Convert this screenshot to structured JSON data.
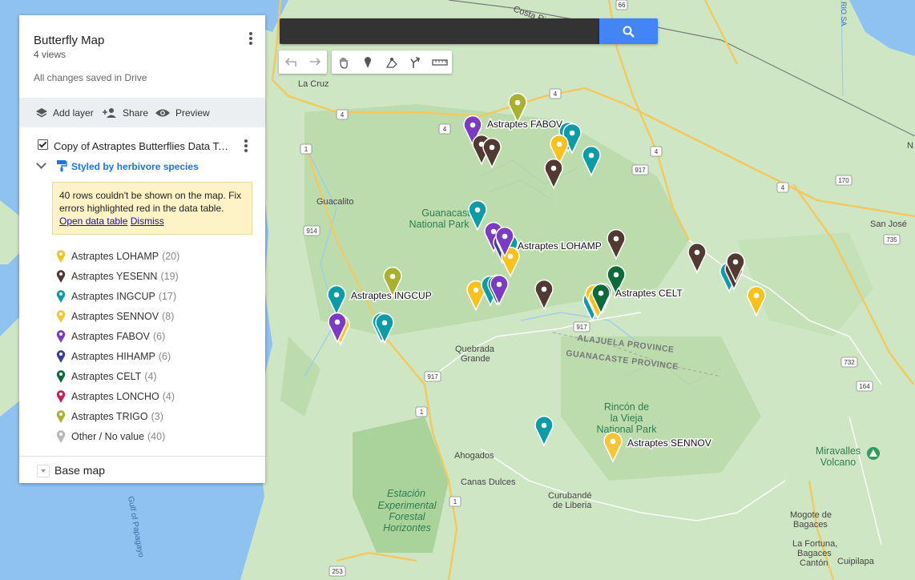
{
  "panel": {
    "title": "Butterfly Map",
    "views": "4 views",
    "saved_status": "All changes saved in Drive",
    "actions": {
      "add_layer": "Add layer",
      "share": "Share",
      "preview": "Preview"
    },
    "layer": {
      "name": "Copy of Astraptes Butterflies Data Table",
      "checked": true,
      "style_label": "Styled by herbivore species"
    },
    "warning": {
      "text": "40 rows couldn't be shown on the map. Fix errors highlighted red in the data table.",
      "open_link": "Open data table",
      "dismiss_link": "Dismiss"
    },
    "legend": [
      {
        "name": "Astraptes LOHAMP",
        "count": "(20)",
        "color": "#f9c11c"
      },
      {
        "name": "Astraptes YESENN",
        "count": "(19)",
        "color": "#523a33"
      },
      {
        "name": "Astraptes INGCUP",
        "count": "(17)",
        "color": "#0d9ba8"
      },
      {
        "name": "Astraptes SENNOV",
        "count": "(8)",
        "color": "#f7c535"
      },
      {
        "name": "Astraptes FABOV",
        "count": "(6)",
        "color": "#7b3bc2"
      },
      {
        "name": "Astraptes HIHAMP",
        "count": "(6)",
        "color": "#3c3f9e"
      },
      {
        "name": "Astraptes CELT",
        "count": "(4)",
        "color": "#0b6b3a"
      },
      {
        "name": "Astraptes LONCHO",
        "count": "(4)",
        "color": "#c9205c"
      },
      {
        "name": "Astraptes TRIGO",
        "count": "(3)",
        "color": "#a8b22f"
      },
      {
        "name": "Other / No value",
        "count": "(40)",
        "color": "#b8b8b8"
      }
    ],
    "base_map": "Base map"
  },
  "search": {
    "value": "",
    "placeholder": ""
  },
  "toolbar": [
    "undo-icon",
    "redo-icon",
    "hand-icon",
    "marker-icon",
    "draw-line-icon",
    "directions-icon",
    "ruler-icon"
  ],
  "map": {
    "place_labels": {
      "la_cruz": "La Cruz",
      "guacalito": "Guacalito",
      "guanacaste_np": [
        "Guanacaste",
        "National Park"
      ],
      "quebrada_grande": [
        "Quebrada",
        "Grande"
      ],
      "rincon": [
        "Rincón de",
        "la Vieja",
        "National Park"
      ],
      "ahogados": "Ahogados",
      "canas_dulces": "Canas Dulces",
      "curubande": [
        "Curubandé",
        "de Liberia"
      ],
      "estacion": [
        "Estación",
        "Experimental",
        "Forestal",
        "Horizontes"
      ],
      "gulf": "Gulf of Papagayo",
      "san_jose": "San José",
      "miravalles": [
        "Miravalles",
        "Volcano"
      ],
      "mogote": [
        "Mogote de",
        "Bagaces"
      ],
      "la_fortuna": [
        "La Fortuna,",
        "Bagaces",
        "Cantón"
      ],
      "cuipilapa": "Cuipilapa",
      "costa_rica": "Costa Rica",
      "alajuela": "ALAJUELA PROVINCE",
      "guanacaste_prov": "GUANACASTE PROVINCE",
      "rio": "RIO SA",
      "n_edge": "N"
    },
    "road_shields": [
      "66",
      "4",
      "4",
      "4",
      "4",
      "1",
      "917",
      "4",
      "170",
      "914",
      "735",
      "917",
      "917",
      "1",
      "732",
      "164",
      "1",
      "253"
    ],
    "pin_labels": {
      "fabov": "Astraptes FABOV",
      "lohamp": "Astraptes LOHAMP",
      "ingcup": "Astraptes INGCUP",
      "celt": "Astraptes CELT",
      "sennov": "Astraptes SENNOV"
    }
  }
}
